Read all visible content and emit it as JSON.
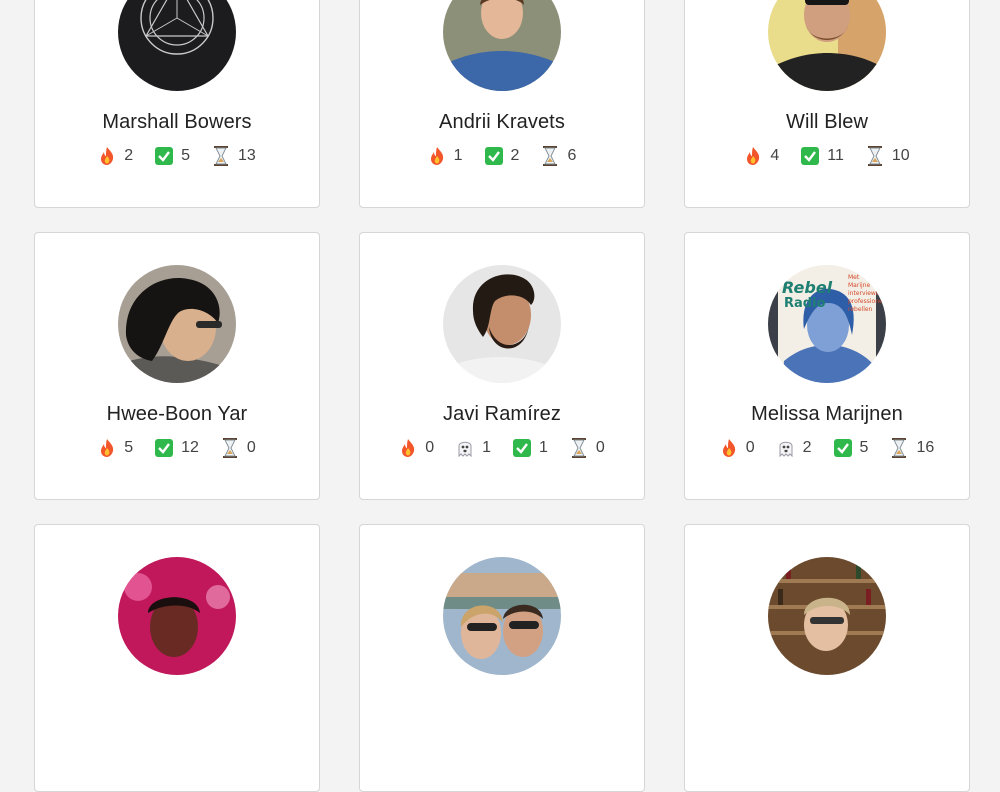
{
  "people": [
    {
      "name": "Marshall Bowers",
      "avatar": "avatar-marshall-bowers",
      "stats": [
        {
          "icon": "fire-icon",
          "value": "2"
        },
        {
          "icon": "check-icon",
          "value": "5"
        },
        {
          "icon": "hourglass-icon",
          "value": "13"
        }
      ]
    },
    {
      "name": "Andrii Kravets",
      "avatar": "avatar-andrii-kravets",
      "stats": [
        {
          "icon": "fire-icon",
          "value": "1"
        },
        {
          "icon": "check-icon",
          "value": "2"
        },
        {
          "icon": "hourglass-icon",
          "value": "6"
        }
      ]
    },
    {
      "name": "Will Blew",
      "avatar": "avatar-will-blew",
      "stats": [
        {
          "icon": "fire-icon",
          "value": "4"
        },
        {
          "icon": "check-icon",
          "value": "11"
        },
        {
          "icon": "hourglass-icon",
          "value": "10"
        }
      ]
    },
    {
      "name": "Hwee-Boon Yar",
      "avatar": "avatar-hwee-boon-yar",
      "stats": [
        {
          "icon": "fire-icon",
          "value": "5"
        },
        {
          "icon": "check-icon",
          "value": "12"
        },
        {
          "icon": "hourglass-icon",
          "value": "0"
        }
      ]
    },
    {
      "name": "Javi Ramírez",
      "avatar": "avatar-javi-ramirez",
      "stats": [
        {
          "icon": "fire-icon",
          "value": "0"
        },
        {
          "icon": "ghost-icon",
          "value": "1"
        },
        {
          "icon": "check-icon",
          "value": "1"
        },
        {
          "icon": "hourglass-icon",
          "value": "0"
        }
      ]
    },
    {
      "name": "Melissa Marijnen",
      "avatar": "avatar-melissa-marijnen",
      "avatar_text": {
        "title": "Rebel Radio",
        "line1": "Met",
        "line2": "Marijne",
        "line3": "interviewt",
        "line4": "professionele",
        "line5": "rebellen"
      },
      "stats": [
        {
          "icon": "fire-icon",
          "value": "0"
        },
        {
          "icon": "ghost-icon",
          "value": "2"
        },
        {
          "icon": "check-icon",
          "value": "5"
        },
        {
          "icon": "hourglass-icon",
          "value": "16"
        }
      ]
    },
    {
      "name": "",
      "avatar": "avatar-pink-portrait",
      "stats": []
    },
    {
      "name": "",
      "avatar": "avatar-couple-canal",
      "stats": []
    },
    {
      "name": "",
      "avatar": "avatar-wine-shelves",
      "stats": []
    }
  ],
  "colors": {
    "background": "#f3f3f3",
    "card": "#ffffff",
    "card_border": "#d6d6d6",
    "check": "#2fb84b",
    "fire": "#f2562a"
  }
}
